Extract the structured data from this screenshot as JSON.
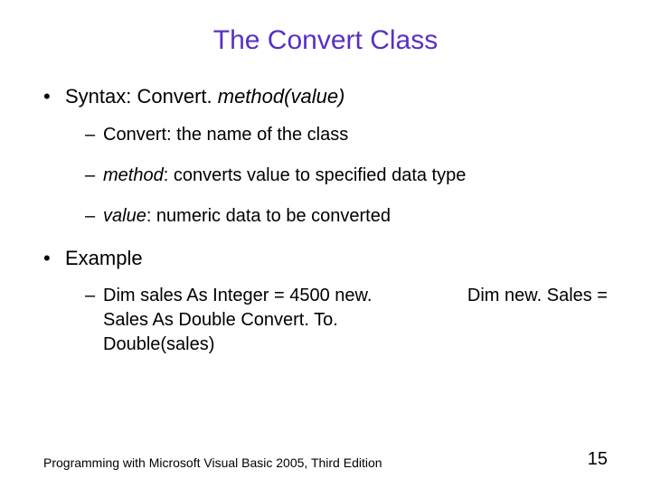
{
  "title": "The Convert Class",
  "bullets": {
    "syntax": {
      "prefix": "Syntax: Convert. ",
      "method_word": "method",
      "value_seg": "(value)"
    },
    "sub1": "Convert: the name of the class",
    "sub2": {
      "method_word": "method",
      "rest": ": converts value to specified data type"
    },
    "sub3": {
      "value_word": "value",
      "rest": ": numeric data to be converted"
    },
    "example_label": "Example",
    "example_left": "Dim sales As Integer = 4500 new. Sales As Double Convert. To. Double(sales)",
    "example_right": "Dim new. Sales ="
  },
  "footer": {
    "text": "Programming with Microsoft Visual Basic 2005, Third Edition",
    "page": "15"
  }
}
